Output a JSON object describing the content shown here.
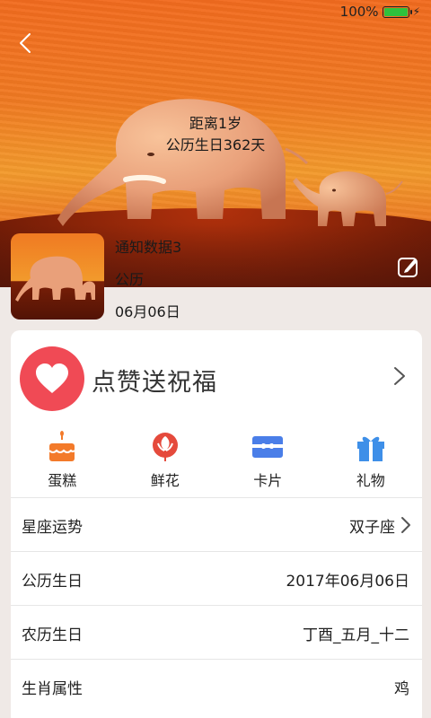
{
  "status_bar": {
    "battery_percent": "100%",
    "battery_level": 1.0
  },
  "hero": {
    "line1": "距离1岁",
    "line2": "公历生日362天"
  },
  "profile": {
    "name": "通知数据3",
    "calendar": "公历",
    "date": "06月06日"
  },
  "like": {
    "title": "点赞送祝福"
  },
  "gifts": [
    {
      "label": "蛋糕",
      "icon": "cake-icon"
    },
    {
      "label": "鲜花",
      "icon": "flower-icon"
    },
    {
      "label": "卡片",
      "icon": "card-icon"
    },
    {
      "label": "礼物",
      "icon": "gift-icon"
    }
  ],
  "info": [
    {
      "key": "星座运势",
      "value": "双子座"
    },
    {
      "key": "公历生日",
      "value": "2017年06月06日"
    },
    {
      "key": "农历生日",
      "value": "丁酉_五月_十二"
    },
    {
      "key": "生肖属性",
      "value": "鸡"
    }
  ],
  "colors": {
    "accent_red": "#f04a55",
    "hero_orange": "#f07a22",
    "cake_orange": "#f37a2a",
    "flower_red": "#e54a3c",
    "card_blue": "#4a7ee8",
    "gift_blue": "#3e8fe8"
  }
}
